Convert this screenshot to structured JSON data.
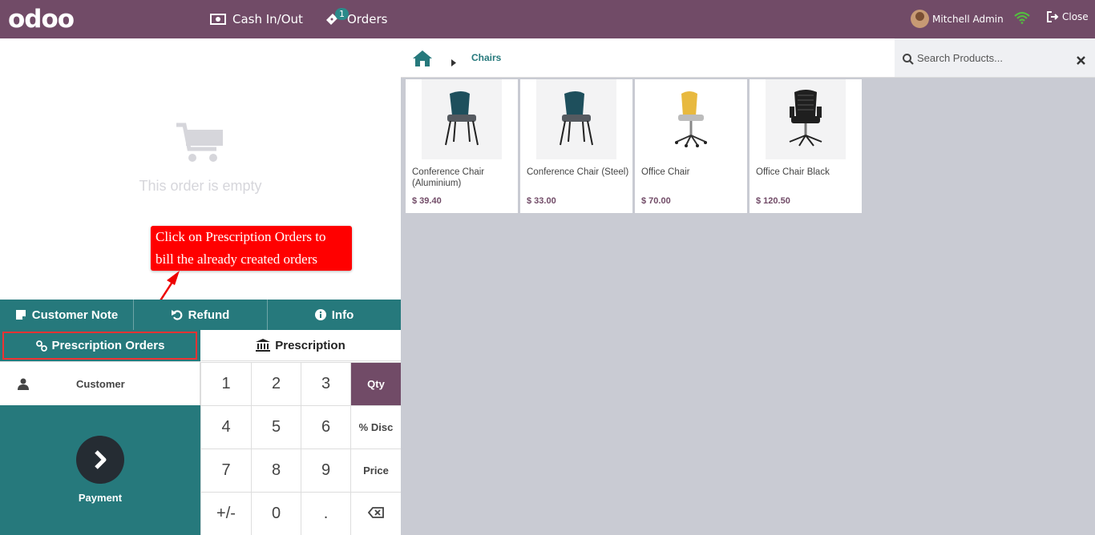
{
  "app": {
    "logo": "odoo"
  },
  "topbar": {
    "cash_label": "Cash In/Out",
    "orders_label": "Orders",
    "orders_badge": "1",
    "user_name": "Mitchell Admin",
    "close_label": "Close"
  },
  "order": {
    "empty_text": "This order is empty"
  },
  "annotation": {
    "text": "Click on Prescription Orders to bill the already created orders"
  },
  "controls": {
    "customer_note": "Customer Note",
    "refund": "Refund",
    "info": "Info",
    "prescription_orders": "Prescription Orders",
    "prescription": "Prescription"
  },
  "customer": {
    "label": "Customer"
  },
  "payment": {
    "label": "Payment"
  },
  "numpad": {
    "keys": [
      "1",
      "2",
      "3",
      "Qty",
      "4",
      "5",
      "6",
      "% Disc",
      "7",
      "8",
      "9",
      "Price",
      "+/-",
      "0",
      "."
    ],
    "active_mode": "Qty"
  },
  "breadcrumb": {
    "current": "Chairs"
  },
  "search": {
    "placeholder": "Search Products..."
  },
  "products": [
    {
      "name": "Conference Chair (Aluminium)",
      "price": "$ 39.40",
      "icon": "teal-chair"
    },
    {
      "name": "Conference Chair (Steel)",
      "price": "$ 33.00",
      "icon": "teal-chair"
    },
    {
      "name": "Office Chair",
      "price": "$ 70.00",
      "icon": "yellow-office-chair"
    },
    {
      "name": "Office Chair Black",
      "price": "$ 120.50",
      "icon": "black-office-chair"
    }
  ],
  "colors": {
    "brand": "#714b67",
    "teal": "#26797c",
    "annotation": "#ff0000"
  }
}
